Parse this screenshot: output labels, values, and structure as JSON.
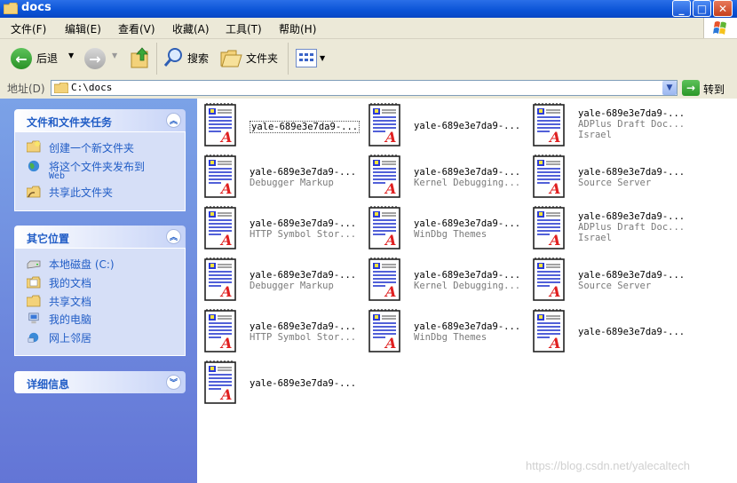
{
  "window": {
    "title": "docs"
  },
  "menu": [
    "文件(F)",
    "编辑(E)",
    "查看(V)",
    "收藏(A)",
    "工具(T)",
    "帮助(H)"
  ],
  "toolbar": {
    "back": "后退",
    "search": "搜索",
    "folders": "文件夹"
  },
  "address": {
    "label": "地址(D)",
    "value": "C:\\docs",
    "go": "转到"
  },
  "tasks": {
    "file_tasks": {
      "title": "文件和文件夹任务",
      "items": [
        "创建一个新文件夹",
        "将这个文件夹发布到",
        "Web",
        "共享此文件夹"
      ]
    },
    "other_places": {
      "title": "其它位置",
      "items": [
        "本地磁盘 (C:)",
        "我的文档",
        "共享文档",
        "我的电脑",
        "网上邻居"
      ]
    },
    "details": {
      "title": "详细信息"
    }
  },
  "files": [
    {
      "name": "yale-689e3e7da9-...",
      "line2": "",
      "line3": ""
    },
    {
      "name": "yale-689e3e7da9-...",
      "line2": "",
      "line3": ""
    },
    {
      "name": "yale-689e3e7da9-...",
      "line2": "ADPlus Draft Doc...",
      "line3": "Israel"
    },
    {
      "name": "yale-689e3e7da9-...",
      "line2": "Debugger Markup",
      "line3": ""
    },
    {
      "name": "yale-689e3e7da9-...",
      "line2": "Kernel Debugging...",
      "line3": ""
    },
    {
      "name": "yale-689e3e7da9-...",
      "line2": "Source Server",
      "line3": ""
    },
    {
      "name": "yale-689e3e7da9-...",
      "line2": "HTTP Symbol Stor...",
      "line3": ""
    },
    {
      "name": "yale-689e3e7da9-...",
      "line2": "WinDbg Themes",
      "line3": ""
    },
    {
      "name": "yale-689e3e7da9-...",
      "line2": "ADPlus Draft Doc...",
      "line3": "Israel"
    },
    {
      "name": "yale-689e3e7da9-...",
      "line2": "Debugger Markup",
      "line3": ""
    },
    {
      "name": "yale-689e3e7da9-...",
      "line2": "Kernel Debugging...",
      "line3": ""
    },
    {
      "name": "yale-689e3e7da9-...",
      "line2": "Source Server",
      "line3": ""
    },
    {
      "name": "yale-689e3e7da9-...",
      "line2": "HTTP Symbol Stor...",
      "line3": ""
    },
    {
      "name": "yale-689e3e7da9-...",
      "line2": "WinDbg Themes",
      "line3": ""
    },
    {
      "name": "yale-689e3e7da9-...",
      "line2": "",
      "line3": ""
    },
    {
      "name": "yale-689e3e7da9-...",
      "line2": "",
      "line3": ""
    }
  ],
  "watermark": "https://blog.csdn.net/yalecaltech"
}
